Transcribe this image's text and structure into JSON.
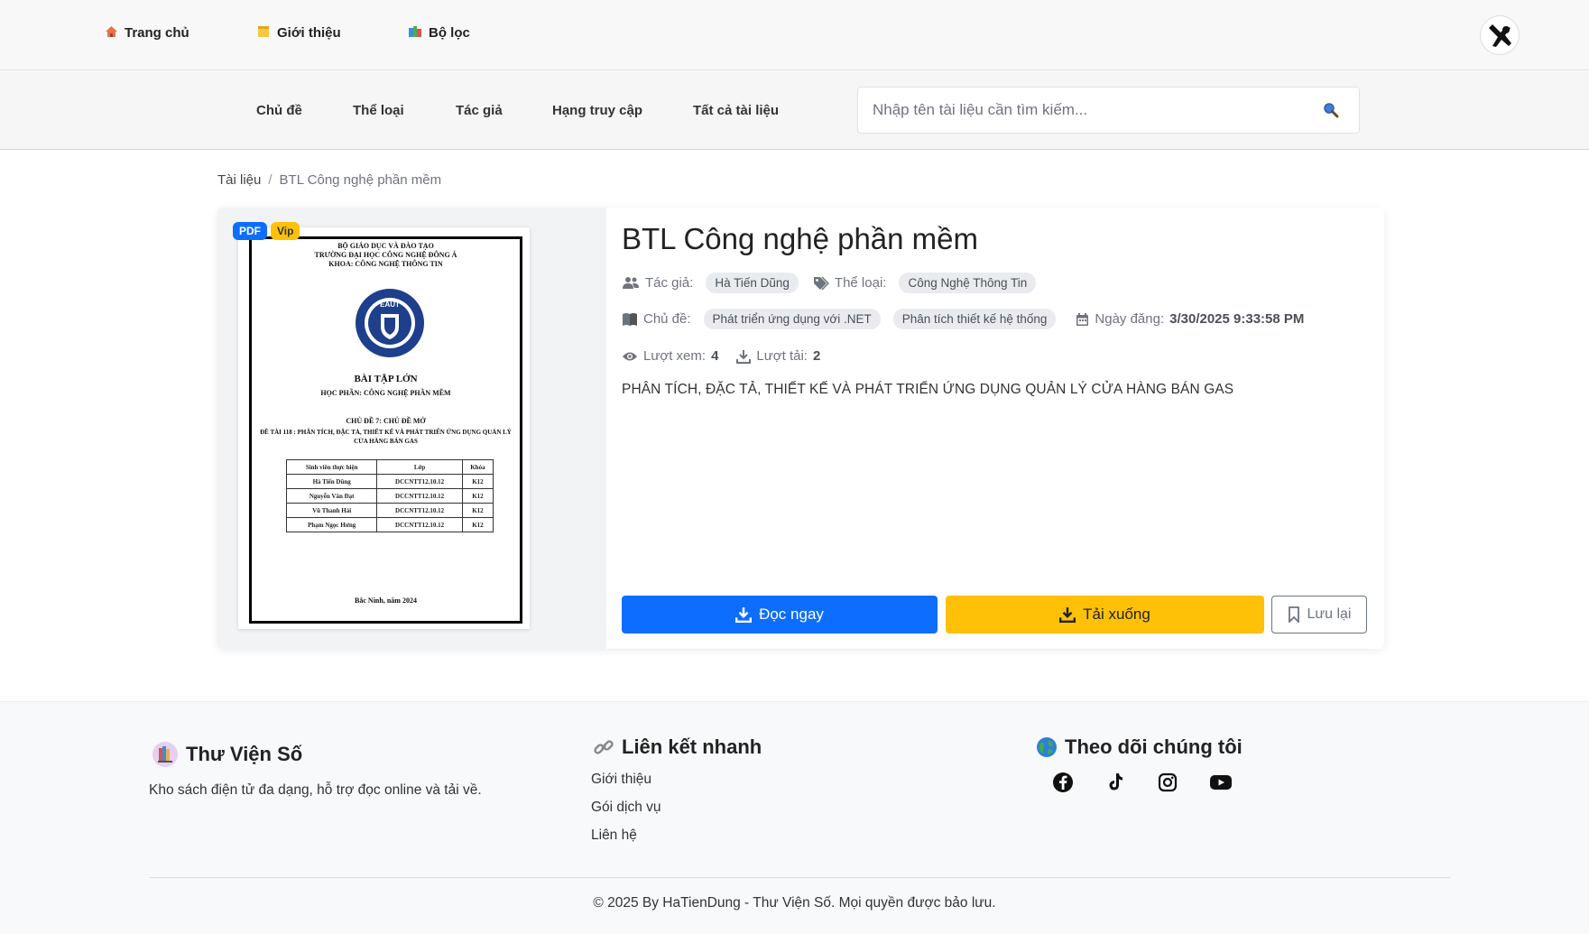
{
  "topnav": {
    "home_icon": "house-icon",
    "home": "Trang chủ",
    "about_icon": "note-icon",
    "about": "Giới thiệu",
    "filter_icon": "books-icon",
    "filter": "Bộ lọc"
  },
  "subnav": {
    "topic": "Chủ đề",
    "genre": "Thể loại",
    "author": "Tác giả",
    "rank": "Hạng truy cập",
    "all": "Tất cả tài liệu"
  },
  "search": {
    "placeholder": "Nhập tên tài liệu cần tìm kiếm...",
    "value": ""
  },
  "breadcrumb": {
    "root": "Tài liệu",
    "separator": "/",
    "current": "BTL Công nghệ phần mềm"
  },
  "document": {
    "badge_format": "PDF",
    "badge_tier": "Vip",
    "title": "BTL Công nghệ phần mềm",
    "author_label": "Tác giả:",
    "author": "Hà Tiến Dũng",
    "genre_label": "Thể loại:",
    "genre": "Công Nghệ Thông Tin",
    "topic_label": "Chủ đề:",
    "topics": [
      "Phát triển ứng dụng với .NET",
      "Phân tích thiết kế hệ thống"
    ],
    "date_label": "Ngày đăng:",
    "date": "3/30/2025 9:33:58 PM",
    "views_label": "Lượt xem:",
    "views": "4",
    "downloads_label": "Lượt tải:",
    "downloads": "2",
    "description": "PHÂN TÍCH, ĐẶC TẢ, THIẾT KẾ VÀ PHÁT TRIỂN ỨNG DỤNG QUẢN LÝ CỬA HÀNG BÁN GAS",
    "read_label": "Đọc ngay",
    "download_label": "Tải xuống",
    "save_label": "Lưu lại"
  },
  "cover": {
    "line1": "BỘ GIÁO DỤC VÀ ĐÀO TẠO",
    "line2": "TRƯỜNG ĐẠI HỌC CÔNG NGHỆ ĐÔNG Á",
    "line3": "KHOA: CÔNG NGHỆ THÔNG TIN",
    "heading": "BÀI TẬP LỚN",
    "course": "HỌC PHẦN: CÔNG NGHỆ PHẦN MỀM",
    "topic": "CHỦ ĐỀ 7: CHỦ ĐỀ MỞ",
    "project": "ĐỀ TÀI 118 : PHÂN TÍCH, ĐẶC TẢ, THIẾT KẾ VÀ PHÁT TRIỂN ỨNG DỤNG QUẢN LÝ CỬA HÀNG BÁN GAS",
    "table_headers": [
      "Sinh viên thực hiện",
      "Lớp",
      "Khóa"
    ],
    "table_rows": [
      [
        "Hà Tiến Dũng",
        "DCCNTT12.10.12",
        "K12"
      ],
      [
        "Nguyễn Văn Đạt",
        "DCCNTT12.10.12",
        "K12"
      ],
      [
        "Vũ Thanh Hải",
        "DCCNTT12.10.12",
        "K12"
      ],
      [
        "Phạm Ngọc Hưng",
        "DCCNTT12.10.12",
        "K12"
      ]
    ],
    "place_date": "Bắc Ninh, năm 2024",
    "seal_text": "EAUT"
  },
  "footer": {
    "brand": "Thư Viện Số",
    "brand_icon": "library-icon",
    "tagline": "Kho sách điện tử đa dạng, hỗ trợ đọc online và tải về.",
    "links_title": "Liên kết nhanh",
    "links_icon": "link-icon",
    "links": [
      "Giới thiệu",
      "Gói dịch vụ",
      "Liên hệ"
    ],
    "follow_title": "Theo dõi chúng tôi",
    "follow_icon": "globe-icon",
    "socials": [
      "facebook-icon",
      "tiktok-icon",
      "instagram-icon",
      "youtube-icon"
    ],
    "copyright": "© 2025 By HaTienDung - Thư Viện Số. Mọi quyền được bảo lưu."
  },
  "colors": {
    "primary": "#0d6efd",
    "warning": "#ffc107",
    "chip_bg": "#e9ecef",
    "muted": "#6c757d"
  }
}
